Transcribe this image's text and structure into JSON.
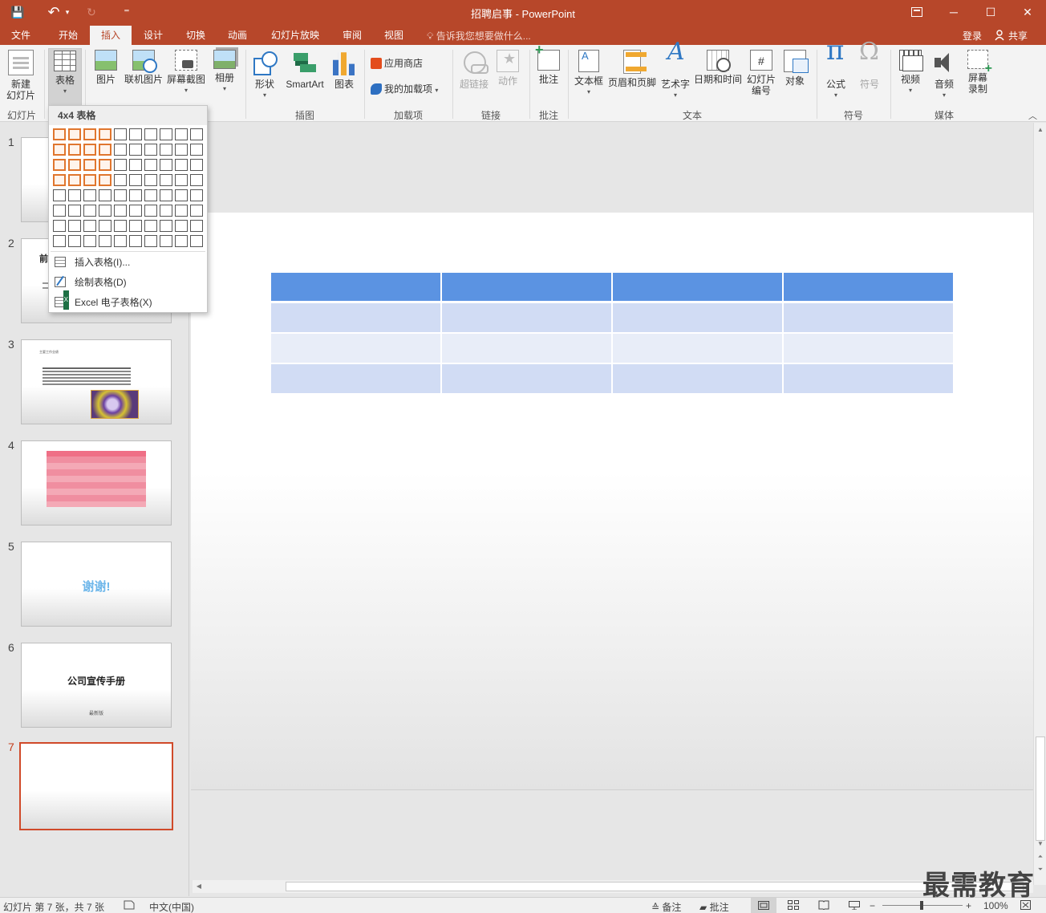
{
  "window": {
    "title": "招聘启事 - PowerPoint",
    "restore_icon": "restore-ribbon-icon",
    "min": "─",
    "max": "☐",
    "close": "✕"
  },
  "quick_access": {
    "save": "💾",
    "undo": "↶",
    "undo_dd": "▾",
    "redo": "↻",
    "customize": "⁼"
  },
  "tabs": [
    "文件",
    "开始",
    "插入",
    "设计",
    "切换",
    "动画",
    "幻灯片放映",
    "审阅",
    "视图"
  ],
  "active_tab": "插入",
  "tellme": "告诉我您想要做什么...",
  "account": {
    "login": "登录",
    "share": "共享"
  },
  "ribbon": {
    "new_slide": "新建\n幻灯片",
    "table": "表格",
    "picture": "图片",
    "online_picture": "联机图片",
    "screenshot": "屏幕截图",
    "album": "相册",
    "shapes": "形状",
    "smartart": "SmartArt",
    "chart": "图表",
    "store": "应用商店",
    "my_addins": "我的加载项",
    "hyperlink": "超链接",
    "action": "动作",
    "comment": "批注",
    "textbox": "文本框",
    "header_footer": "页眉和页脚",
    "wordart": "艺术字",
    "datetime": "日期和时间",
    "slide_number": "幻灯片\n编号",
    "object": "对象",
    "equation": "公式",
    "symbol": "符号",
    "video": "视频",
    "audio": "音频",
    "screen_record": "屏幕\n录制",
    "groups": {
      "slides": "幻灯片",
      "images": "插图",
      "addins": "加载项",
      "links": "链接",
      "comments": "批注",
      "text": "文本",
      "symbols": "符号",
      "media": "媒体"
    }
  },
  "table_menu": {
    "header": "4x4 表格",
    "grid_cols": 10,
    "grid_rows": 8,
    "selected_cols": 4,
    "selected_rows": 4,
    "insert_table": "插入表格(I)...",
    "draw_table": "绘制表格(D)",
    "excel_table": "Excel 电子表格(X)"
  },
  "slides": [
    {
      "num": "1"
    },
    {
      "num": "2",
      "title": "前"
    },
    {
      "num": "3",
      "heading": "主要工作业绩"
    },
    {
      "num": "4"
    },
    {
      "num": "5",
      "title": "谢谢!"
    },
    {
      "num": "6",
      "title": "公司宣传手册",
      "subtitle": "最新版"
    },
    {
      "num": "7"
    }
  ],
  "current_slide": 7,
  "status": {
    "slide_info": "幻灯片 第 7 张，共 7 张",
    "language": "中文(中国)",
    "notes": "备注",
    "comments": "批注",
    "zoom": "100%"
  },
  "watermark": "最需教育",
  "colors": {
    "accent": "#b7472a",
    "table_header": "#5b93e2",
    "table_row_a": "#d1dcf4",
    "table_row_b": "#e8edf8",
    "grid_highlight": "#e0762e"
  }
}
